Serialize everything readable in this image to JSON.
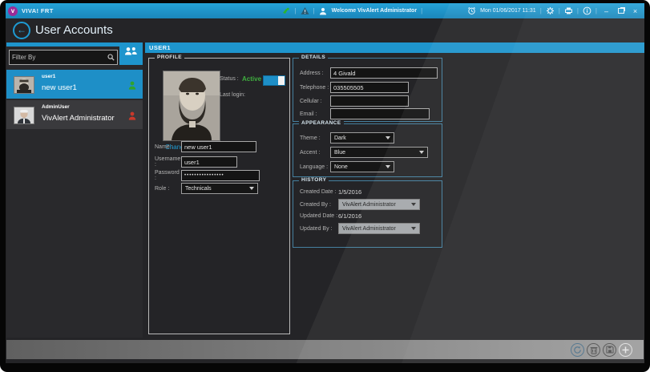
{
  "colors": {
    "accent_blue": "#1e8fc7",
    "titlebar_blue": "#1e97d2",
    "active_green": "#3fae3f",
    "status_green": "#2fa32f",
    "status_red": "#c8392b",
    "logo_purple": "#9b2c97"
  },
  "titlebar": {
    "app_title": "VIVA! FRT",
    "welcome_text": "Welcome  VivAlert Administrator",
    "datetime_text": "Mon 01/06/2017 11:31",
    "minimize_glyph": "–",
    "close_glyph": "×",
    "logo_glyph": "v"
  },
  "page": {
    "title": "User Accounts"
  },
  "sidebar": {
    "filter_placeholder": "Filter By",
    "users": [
      {
        "username": "user1",
        "display_name": "new user1"
      },
      {
        "username": "AdminUser",
        "display_name": "VivAlert Administrator"
      }
    ]
  },
  "content": {
    "user_header": "USER1",
    "profile": {
      "title": "PROFILE",
      "change_link": "Change",
      "status_label": "Status :",
      "status_value": "Active",
      "last_login_label": "Last login:",
      "name_label": "Name :",
      "name_value": "new user1",
      "username_label": "Username :",
      "username_value": "user1",
      "password_label": "Password :",
      "password_value": "••••••••••••••••",
      "role_label": "Role :",
      "role_value": "Technicals"
    },
    "details": {
      "title": "DETAILS",
      "address_label": "Address :",
      "address_value": "4 Givald",
      "telephone_label": "Telephone :",
      "telephone_value": "035505505",
      "cellular_label": "Cellular :",
      "cellular_value": "",
      "email_label": "Email :",
      "email_value": ""
    },
    "appearance": {
      "title": "APPEARANCE",
      "theme_label": "Theme :",
      "theme_value": "Dark",
      "accent_label": "Accent :",
      "accent_value": "Blue",
      "language_label": "Language :",
      "language_value": "None"
    },
    "history": {
      "title": "HISTORY",
      "created_date_label": "Created Date :",
      "created_date_value": "1/5/2016",
      "created_by_label": "Created By :",
      "created_by_value": "VivAlert Administrator",
      "updated_date_label": "Updated Date :",
      "updated_date_value": "6/1/2016",
      "updated_by_label": "Updated By :",
      "updated_by_value": "VivAlert Administrator"
    }
  }
}
